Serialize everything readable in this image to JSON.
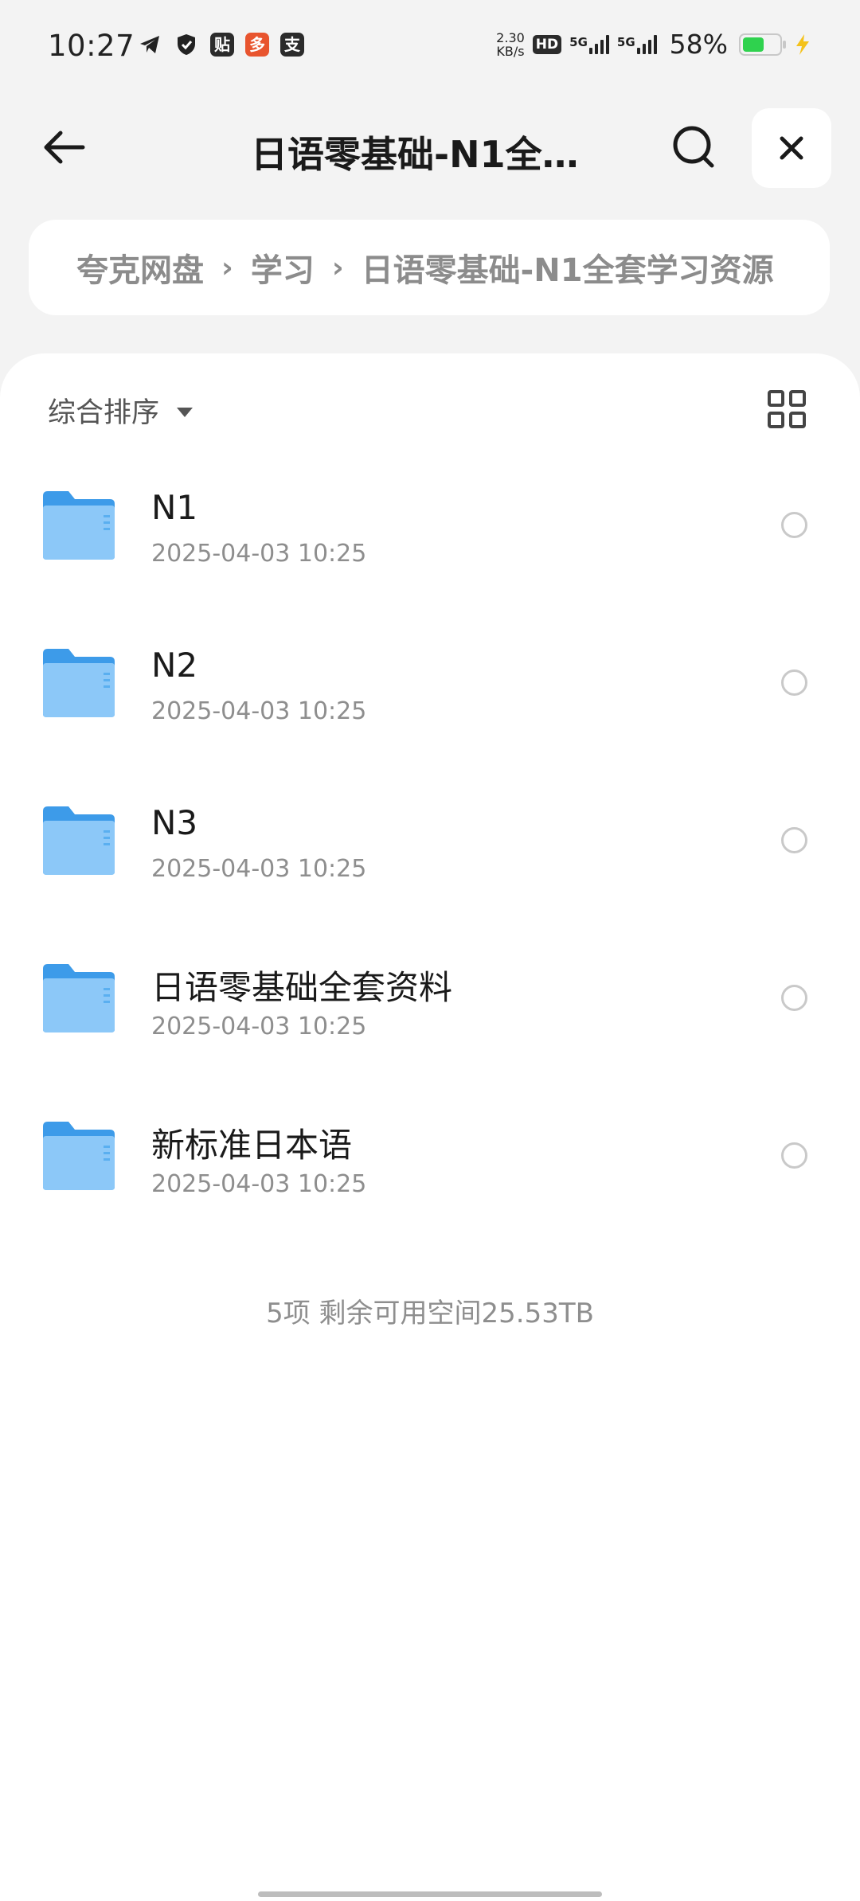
{
  "status_bar": {
    "time": "10:27",
    "speed_value": "2.30",
    "speed_unit": "KB/s",
    "hd_label": "HD",
    "sim1_label": "5G",
    "sim2_label": "5G",
    "battery_percent": "58%",
    "battery_level": 0.58,
    "left_icons": [
      "telegram-icon",
      "shield-icon",
      "tieba-icon",
      "pinduoduo-icon",
      "alipay-icon"
    ],
    "tieba_label": "贴",
    "pdd_label": "多",
    "alipay_label": "支"
  },
  "header": {
    "title": "日语零基础-N1全…"
  },
  "breadcrumb": {
    "items": [
      "夸克网盘",
      "学习",
      "日语零基础-N1全套学习资源"
    ]
  },
  "toolbar": {
    "sort_label": "综合排序"
  },
  "files": [
    {
      "name": "N1",
      "date": "2025-04-03 10:25"
    },
    {
      "name": "N2",
      "date": "2025-04-03 10:25"
    },
    {
      "name": "N3",
      "date": "2025-04-03 10:25"
    },
    {
      "name": "日语零基础全套资料",
      "date": "2025-04-03 10:25"
    },
    {
      "name": "新标准日本语",
      "date": "2025-04-03 10:25"
    }
  ],
  "footer": {
    "summary": "5项 剩余可用空间25.53TB"
  },
  "colors": {
    "background": "#f3f3f3",
    "panel": "#ffffff",
    "folder_blue": "#5aaff0",
    "battery_green": "#2fd24e"
  }
}
